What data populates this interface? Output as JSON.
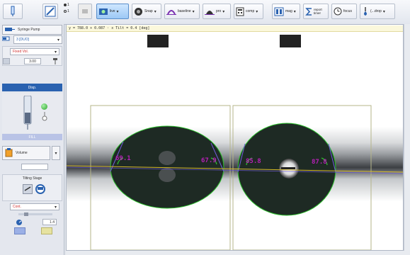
{
  "toolbar": {
    "radio_1": "1",
    "radio_2": "1",
    "live_label": "live",
    "snap_label": "Snap",
    "baseline_label": "baseline",
    "pro_label": "pro",
    "comp_label": "comp",
    "mag_label": "mag",
    "report_label": "report\ntimer",
    "focus_label": "focus",
    "drop_label": "(...drop"
  },
  "left_panel": {
    "device_title": "Syringe Pump",
    "syringe_select": "3 [DUO]",
    "mode_select": "Fixed Vol.",
    "volume_value": "3.00",
    "dispense_button": "Disp.",
    "fill_button": "FILL",
    "volume_dropdown": "Volume",
    "tilting_title": "Tilting Stage",
    "tilt_mode_select": "Cont.",
    "tilt_value": "1.4"
  },
  "view": {
    "info_text": "y = 788.0 + 0.087 · x    Tilt = 0.4 [deg]",
    "angles": {
      "drop1_left": "69.1",
      "drop1_right": "67.9",
      "drop2_left": "85.8",
      "drop2_right": "87.8"
    }
  },
  "colors": {
    "accent_blue": "#2a62b0",
    "angle_label": "#b520b5",
    "fit_line": "#2ec22e",
    "baseline": "#d4b82a",
    "roi_box": "#b5b58a"
  }
}
